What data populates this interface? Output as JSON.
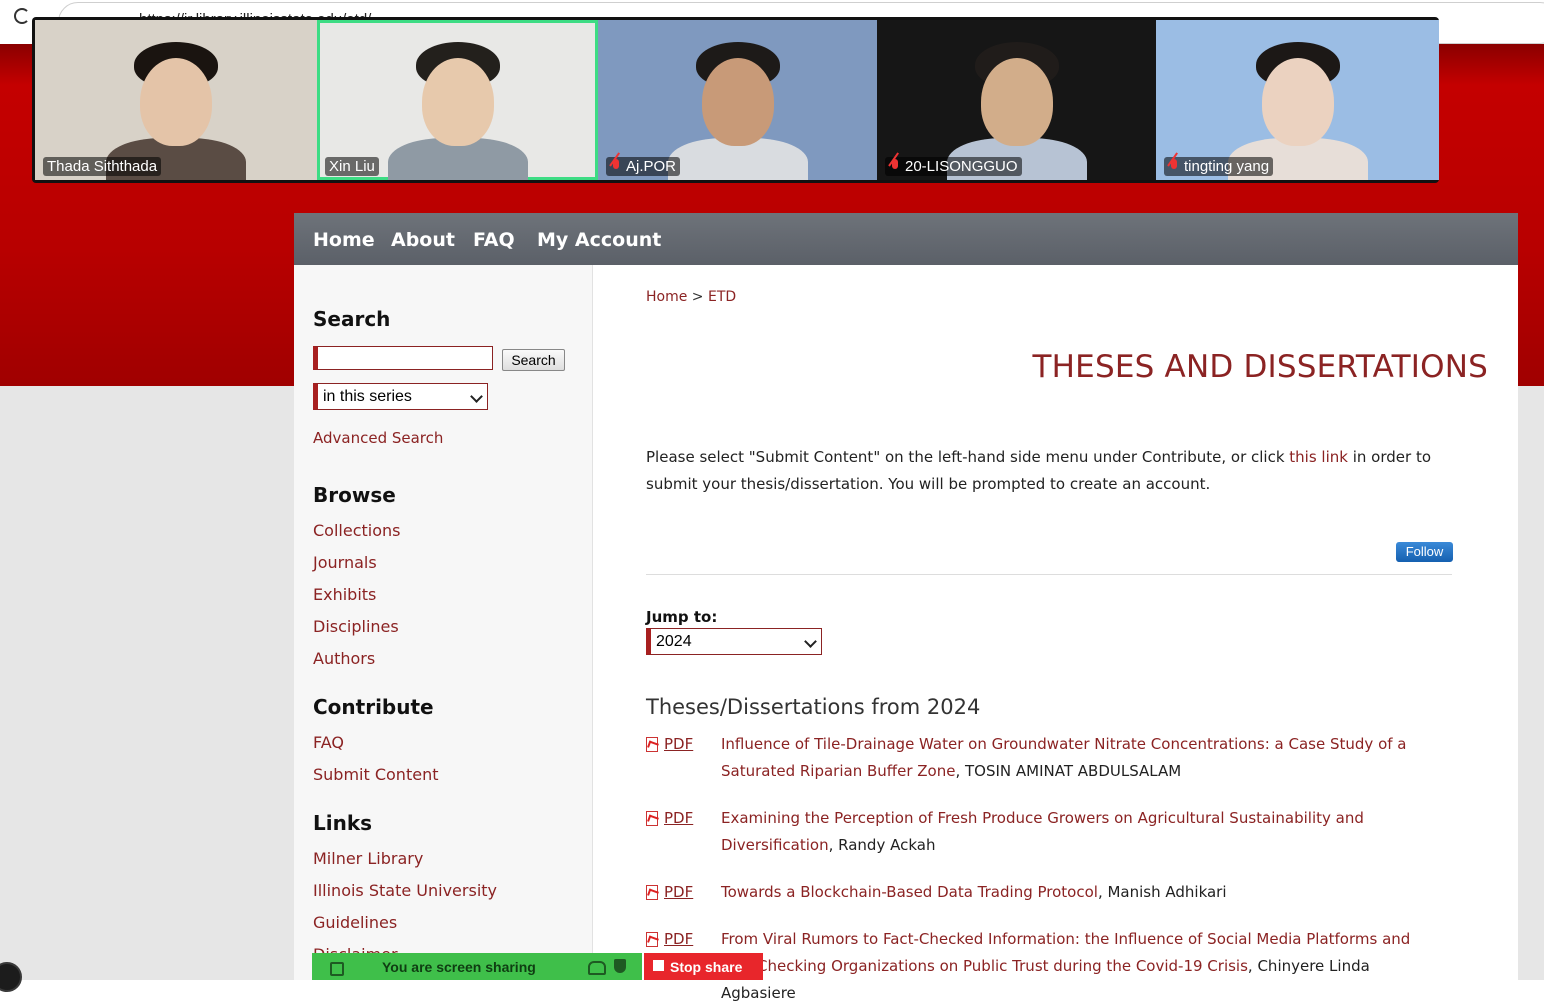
{
  "browser": {
    "url": "https://ir.library.illinoisstate.edu/etd/"
  },
  "video": {
    "participants": [
      {
        "name": "Thada Siththada",
        "muted": false,
        "bg": "#d8d2c8",
        "hair": "#1a1410",
        "shirt": "#5a4c44",
        "skin": "#e4c4a8"
      },
      {
        "name": "Xin Liu",
        "muted": false,
        "bg": "#e8e8e6",
        "hair": "#23201c",
        "shirt": "#8f9aa4",
        "skin": "#e7c9ac",
        "speaking": true
      },
      {
        "name": "Aj.POR",
        "muted": true,
        "bg": "#7f99bf",
        "hair": "#1d1a18",
        "shirt": "#d9dce0",
        "skin": "#c89a78"
      },
      {
        "name": "20-LISONGGUO",
        "muted": true,
        "bg": "#161616",
        "hair": "#201c1a",
        "shirt": "#b7c3d4",
        "skin": "#d2ad8a"
      },
      {
        "name": "tingting yang",
        "muted": true,
        "bg": "#9bbde4",
        "hair": "#1c1816",
        "shirt": "#e7ded8",
        "skin": "#ebd2c0"
      }
    ]
  },
  "nav": {
    "home": "Home",
    "about": "About",
    "faq": "FAQ",
    "account": "My Account"
  },
  "sidebar": {
    "search_heading": "Search",
    "search_button": "Search",
    "search_scope": "in this series",
    "advanced_search": "Advanced Search",
    "browse_heading": "Browse",
    "browse_links": [
      "Collections",
      "Journals",
      "Exhibits",
      "Disciplines",
      "Authors"
    ],
    "contribute_heading": "Contribute",
    "contribute_links": [
      "FAQ",
      "Submit Content"
    ],
    "links_heading": "Links",
    "links": [
      "Milner Library",
      "Illinois State University",
      "Guidelines",
      "Disclaimer"
    ]
  },
  "main": {
    "breadcrumb_home": "Home",
    "breadcrumb_sep": ">",
    "breadcrumb_current": "ETD",
    "title": "THESES AND DISSERTATIONS",
    "intro_before": "Please select \"Submit Content\" on the left-hand side menu under Contribute, or click ",
    "intro_link": "this link",
    "intro_after": " in order to submit your thesis/dissertation. You will be prompted to create an account.",
    "follow": "Follow",
    "jump_label": "Jump to:",
    "jump_value": "2024",
    "section_title": "Theses/Dissertations from 2024",
    "pdf_label": "PDF",
    "entries": [
      {
        "title": "Influence of Tile-Drainage Water on Groundwater Nitrate Concentrations: a Case Study of a Saturated Riparian Buffer Zone",
        "author": ", TOSIN AMINAT ABDULSALAM"
      },
      {
        "title": "Examining the Perception of Fresh Produce Growers on Agricultural Sustainability and Diversification",
        "author": ", Randy Ackah"
      },
      {
        "title": "Towards a Blockchain-Based Data Trading Protocol",
        "author": ", Manish Adhikari"
      },
      {
        "title": "From Viral Rumors to Fact-Checked Information: the Influence of Social Media Platforms and Fact-Checking Organizations on Public Trust during the Covid-19 Crisis",
        "author": ", Chinyere Linda Agbasiere"
      }
    ]
  },
  "screenshare": {
    "status": "You are screen sharing",
    "stop": "Stop share"
  },
  "colors": {
    "accent": "#8b2323",
    "header_red": "#c40000",
    "nav_gray": "#62676e",
    "share_green": "#3fbf4a",
    "stop_red": "#e8262b"
  }
}
